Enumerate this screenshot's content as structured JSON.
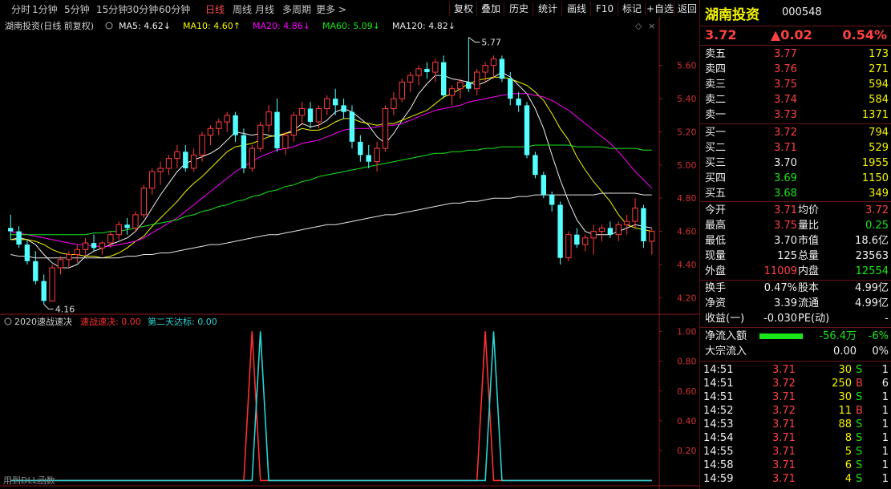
{
  "toolbar": {
    "timeframes": [
      "分时",
      "1分钟",
      "5分钟",
      "15分钟",
      "30分钟",
      "60分钟",
      "日线",
      "周线",
      "月线",
      "多周期",
      "更多 >"
    ],
    "active_timeframe": "日线",
    "buttons": [
      "复权",
      "叠加",
      "历史",
      "统计",
      "画线",
      "F10",
      "标记",
      "+自选",
      "返回"
    ]
  },
  "legend": {
    "title": "湖南投资(日线 前复权)",
    "items": [
      {
        "label": "MA5: 4.62↓",
        "color": "#f0f0f0"
      },
      {
        "label": "MA10: 4.60↑",
        "color": "#f5f500"
      },
      {
        "label": "MA20: 4.86↓",
        "color": "#ff00ff"
      },
      {
        "label": "MA60: 5.09↓",
        "color": "#19e619"
      },
      {
        "label": "MA120: 4.82↓",
        "color": "#e6e6e6"
      }
    ]
  },
  "indicator": {
    "name": "2020速战速决",
    "items": [
      {
        "label": "速战速决: 0.00",
        "color": "#ff3030"
      },
      {
        "label": "第二天达标: 0.00",
        "color": "#2ad3d3"
      }
    ]
  },
  "chart_data": [
    {
      "type": "candlestick",
      "y_ticks": [
        "5.60",
        "5.40",
        "5.20",
        "5.00",
        "4.80",
        "4.60",
        "4.40",
        "4.20"
      ],
      "ylim": [
        4.1,
        5.85
      ],
      "annotations": {
        "high": "5.77",
        "low": "4.16"
      },
      "candles": [
        [
          4.62,
          4.7,
          4.55,
          4.6
        ],
        [
          4.6,
          4.63,
          4.5,
          4.52
        ],
        [
          4.52,
          4.55,
          4.4,
          4.42
        ],
        [
          4.42,
          4.48,
          4.28,
          4.3
        ],
        [
          4.3,
          4.34,
          4.16,
          4.18
        ],
        [
          4.18,
          4.4,
          4.18,
          4.38
        ],
        [
          4.38,
          4.45,
          4.34,
          4.43
        ],
        [
          4.43,
          4.48,
          4.38,
          4.46
        ],
        [
          4.46,
          4.52,
          4.41,
          4.49
        ],
        [
          4.49,
          4.56,
          4.45,
          4.53
        ],
        [
          4.53,
          4.58,
          4.48,
          4.5
        ],
        [
          4.5,
          4.54,
          4.46,
          4.53
        ],
        [
          4.53,
          4.6,
          4.5,
          4.58
        ],
        [
          4.58,
          4.66,
          4.55,
          4.64
        ],
        [
          4.64,
          4.68,
          4.58,
          4.62
        ],
        [
          4.62,
          4.72,
          4.6,
          4.7
        ],
        [
          4.7,
          4.88,
          4.68,
          4.86
        ],
        [
          4.86,
          4.98,
          4.82,
          4.96
        ],
        [
          4.96,
          5.02,
          4.88,
          4.98
        ],
        [
          4.98,
          5.06,
          4.94,
          5.04
        ],
        [
          5.04,
          5.12,
          4.98,
          5.08
        ],
        [
          5.08,
          5.12,
          4.96,
          4.98
        ],
        [
          4.98,
          5.1,
          4.96,
          5.06
        ],
        [
          5.06,
          5.2,
          5.02,
          5.18
        ],
        [
          5.18,
          5.24,
          5.12,
          5.22
        ],
        [
          5.22,
          5.28,
          5.18,
          5.26
        ],
        [
          5.26,
          5.32,
          5.2,
          5.3
        ],
        [
          5.3,
          5.32,
          5.14,
          5.18
        ],
        [
          5.18,
          5.22,
          4.95,
          4.98
        ],
        [
          4.98,
          5.12,
          4.96,
          5.1
        ],
        [
          5.1,
          5.26,
          5.08,
          5.24
        ],
        [
          5.24,
          5.36,
          5.2,
          5.32
        ],
        [
          5.32,
          5.4,
          5.08,
          5.1
        ],
        [
          5.1,
          5.2,
          5.06,
          5.18
        ],
        [
          5.18,
          5.32,
          5.14,
          5.3
        ],
        [
          5.3,
          5.38,
          5.24,
          5.34
        ],
        [
          5.34,
          5.38,
          5.22,
          5.26
        ],
        [
          5.26,
          5.36,
          5.22,
          5.34
        ],
        [
          5.34,
          5.42,
          5.3,
          5.4
        ],
        [
          5.4,
          5.46,
          5.3,
          5.36
        ],
        [
          5.36,
          5.4,
          5.28,
          5.32
        ],
        [
          5.32,
          5.36,
          5.1,
          5.14
        ],
        [
          5.14,
          5.18,
          5.02,
          5.06
        ],
        [
          5.06,
          5.12,
          4.98,
          5.02
        ],
        [
          5.02,
          5.14,
          4.96,
          5.1
        ],
        [
          5.1,
          5.36,
          5.08,
          5.34
        ],
        [
          5.34,
          5.44,
          5.3,
          5.4
        ],
        [
          5.4,
          5.52,
          5.38,
          5.5
        ],
        [
          5.5,
          5.56,
          5.44,
          5.54
        ],
        [
          5.54,
          5.6,
          5.48,
          5.58
        ],
        [
          5.58,
          5.62,
          5.52,
          5.56
        ],
        [
          5.56,
          5.64,
          5.5,
          5.62
        ],
        [
          5.62,
          5.66,
          5.4,
          5.42
        ],
        [
          5.42,
          5.48,
          5.36,
          5.46
        ],
        [
          5.46,
          5.52,
          5.4,
          5.5
        ],
        [
          5.5,
          5.77,
          5.44,
          5.46
        ],
        [
          5.46,
          5.58,
          5.42,
          5.56
        ],
        [
          5.56,
          5.62,
          5.5,
          5.6
        ],
        [
          5.6,
          5.66,
          5.52,
          5.64
        ],
        [
          5.64,
          5.66,
          5.5,
          5.52
        ],
        [
          5.52,
          5.56,
          5.36,
          5.4
        ],
        [
          5.4,
          5.44,
          5.32,
          5.36
        ],
        [
          5.36,
          5.38,
          5.04,
          5.06
        ],
        [
          5.06,
          5.08,
          4.92,
          4.94
        ],
        [
          4.94,
          4.96,
          4.8,
          4.82
        ],
        [
          4.82,
          4.84,
          4.72,
          4.76
        ],
        [
          4.76,
          4.78,
          4.4,
          4.44
        ],
        [
          4.44,
          4.6,
          4.42,
          4.58
        ],
        [
          4.58,
          4.62,
          4.5,
          4.52
        ],
        [
          4.52,
          4.58,
          4.48,
          4.56
        ],
        [
          4.56,
          4.64,
          4.46,
          4.6
        ],
        [
          4.6,
          4.64,
          4.54,
          4.62
        ],
        [
          4.62,
          4.66,
          4.56,
          4.58
        ],
        [
          4.58,
          4.66,
          4.54,
          4.64
        ],
        [
          4.64,
          4.7,
          4.58,
          4.66
        ],
        [
          4.66,
          4.8,
          4.62,
          4.74
        ],
        [
          4.74,
          4.76,
          4.5,
          4.54
        ],
        [
          4.54,
          4.62,
          4.46,
          4.6
        ]
      ],
      "ma": {
        "MA5": {
          "color": "#f0f0f0",
          "values": [
            4.55,
            4.56,
            4.55,
            4.52,
            4.46,
            4.41,
            4.38,
            4.38,
            4.4,
            4.45,
            4.48,
            4.5,
            4.52,
            4.54,
            4.56,
            4.6,
            4.66,
            4.74,
            4.82,
            4.89,
            4.96,
            5.01,
            5.03,
            5.05,
            5.07,
            5.1,
            5.15,
            5.2,
            5.19,
            5.18,
            5.19,
            5.18,
            5.17,
            5.19,
            5.21,
            5.25,
            5.23,
            5.24,
            5.27,
            5.32,
            5.34,
            5.32,
            5.28,
            5.24,
            5.17,
            5.13,
            5.19,
            5.27,
            5.34,
            5.43,
            5.49,
            5.54,
            5.54,
            5.52,
            5.51,
            5.5,
            5.48,
            5.5,
            5.53,
            5.56,
            5.53,
            5.48,
            5.43,
            5.34,
            5.22,
            5.06,
            4.91,
            4.78,
            4.67,
            4.6,
            4.58,
            4.58,
            4.58,
            4.6,
            4.62,
            4.64,
            4.63,
            4.62
          ]
        },
        "MA10": {
          "color": "#f5f500",
          "values": [
            4.55,
            4.55,
            4.55,
            4.54,
            4.52,
            4.49,
            4.47,
            4.46,
            4.46,
            4.45,
            4.45,
            4.44,
            4.45,
            4.47,
            4.5,
            4.54,
            4.57,
            4.63,
            4.68,
            4.73,
            4.78,
            4.84,
            4.89,
            4.93,
            4.98,
            5.03,
            5.08,
            5.11,
            5.12,
            5.13,
            5.15,
            5.17,
            5.18,
            5.19,
            5.2,
            5.22,
            5.21,
            5.21,
            5.23,
            5.26,
            5.28,
            5.28,
            5.26,
            5.25,
            5.24,
            5.25,
            5.25,
            5.27,
            5.29,
            5.31,
            5.33,
            5.37,
            5.41,
            5.43,
            5.46,
            5.49,
            5.51,
            5.52,
            5.53,
            5.53,
            5.52,
            5.5,
            5.48,
            5.44,
            5.39,
            5.31,
            5.22,
            5.15,
            5.05,
            4.97,
            4.9,
            4.84,
            4.78,
            4.7,
            4.64,
            4.62,
            4.61,
            4.6
          ]
        },
        "MA20": {
          "color": "#ff00ff",
          "values": [
            4.6,
            4.59,
            4.58,
            4.57,
            4.56,
            4.55,
            4.54,
            4.53,
            4.52,
            4.52,
            4.51,
            4.51,
            4.51,
            4.52,
            4.53,
            4.54,
            4.56,
            4.59,
            4.62,
            4.65,
            4.68,
            4.72,
            4.76,
            4.8,
            4.84,
            4.88,
            4.92,
            4.96,
            4.99,
            5.02,
            5.05,
            5.07,
            5.09,
            5.1,
            5.11,
            5.13,
            5.14,
            5.15,
            5.17,
            5.19,
            5.21,
            5.22,
            5.22,
            5.22,
            5.23,
            5.24,
            5.24,
            5.25,
            5.27,
            5.29,
            5.31,
            5.33,
            5.34,
            5.35,
            5.36,
            5.38,
            5.39,
            5.4,
            5.41,
            5.42,
            5.43,
            5.43,
            5.43,
            5.42,
            5.41,
            5.39,
            5.36,
            5.33,
            5.29,
            5.25,
            5.21,
            5.17,
            5.13,
            5.08,
            5.02,
            4.96,
            4.91,
            4.86
          ]
        },
        "MA60": {
          "color": "#19e619",
          "values": [
            4.58,
            4.58,
            4.58,
            4.58,
            4.58,
            4.58,
            4.58,
            4.58,
            4.58,
            4.58,
            4.59,
            4.59,
            4.6,
            4.6,
            4.61,
            4.62,
            4.63,
            4.64,
            4.65,
            4.66,
            4.67,
            4.69,
            4.7,
            4.72,
            4.73,
            4.75,
            4.76,
            4.78,
            4.79,
            4.81,
            4.82,
            4.84,
            4.85,
            4.87,
            4.88,
            4.9,
            4.91,
            4.93,
            4.94,
            4.95,
            4.96,
            4.97,
            4.98,
            4.99,
            5.0,
            5.01,
            5.02,
            5.03,
            5.04,
            5.05,
            5.06,
            5.07,
            5.07,
            5.08,
            5.08,
            5.09,
            5.09,
            5.1,
            5.1,
            5.11,
            5.11,
            5.11,
            5.11,
            5.12,
            5.12,
            5.12,
            5.12,
            5.12,
            5.11,
            5.11,
            5.11,
            5.11,
            5.1,
            5.1,
            5.1,
            5.1,
            5.09,
            5.09
          ]
        },
        "MA120": {
          "color": "#e6e6e6",
          "values": [
            4.46,
            4.45,
            4.45,
            4.44,
            4.44,
            4.44,
            4.44,
            4.44,
            4.44,
            4.44,
            4.44,
            4.44,
            4.44,
            4.44,
            4.45,
            4.45,
            4.46,
            4.46,
            4.47,
            4.47,
            4.48,
            4.49,
            4.5,
            4.51,
            4.52,
            4.52,
            4.53,
            4.54,
            4.55,
            4.56,
            4.57,
            4.58,
            4.58,
            4.59,
            4.6,
            4.61,
            4.62,
            4.63,
            4.64,
            4.64,
            4.65,
            4.66,
            4.67,
            4.68,
            4.69,
            4.7,
            4.7,
            4.71,
            4.72,
            4.73,
            4.74,
            4.75,
            4.76,
            4.77,
            4.77,
            4.78,
            4.78,
            4.79,
            4.8,
            4.8,
            4.8,
            4.81,
            4.81,
            4.82,
            4.82,
            4.82,
            4.82,
            4.82,
            4.82,
            4.82,
            4.82,
            4.83,
            4.83,
            4.83,
            4.83,
            4.83,
            4.82,
            4.82
          ]
        }
      }
    },
    {
      "type": "line",
      "y_ticks": [
        "1.00",
        "0.80",
        "0.60",
        "0.40",
        "0.20"
      ],
      "ylim": [
        -0.03,
        1.05
      ],
      "series": [
        {
          "name": "速战速决",
          "color": "#ff3030",
          "spike_index": [
            29,
            57
          ]
        },
        {
          "name": "第二天达标",
          "color": "#2ad3d3",
          "spike_index": [
            30,
            58
          ]
        }
      ],
      "bars": 78
    }
  ],
  "footer_text": "用到DLL函数",
  "panel": {
    "stock_name": "湖南投资",
    "stock_code": "000548",
    "price": "3.72",
    "change": "▲0.02",
    "change_pct": "0.54%",
    "asks": [
      {
        "label": "卖五",
        "price": "3.77",
        "vol": "173"
      },
      {
        "label": "卖四",
        "price": "3.76",
        "vol": "271"
      },
      {
        "label": "卖三",
        "price": "3.75",
        "vol": "594"
      },
      {
        "label": "卖二",
        "price": "3.74",
        "vol": "584"
      },
      {
        "label": "卖一",
        "price": "3.73",
        "vol": "1371"
      }
    ],
    "bids": [
      {
        "label": "买一",
        "price": "3.72",
        "vol": "794",
        "pc": "red"
      },
      {
        "label": "买二",
        "price": "3.71",
        "vol": "529",
        "pc": "red"
      },
      {
        "label": "买三",
        "price": "3.70",
        "vol": "1955",
        "pc": "white"
      },
      {
        "label": "买四",
        "price": "3.69",
        "vol": "1150",
        "pc": "green"
      },
      {
        "label": "买五",
        "price": "3.68",
        "vol": "349",
        "pc": "green"
      }
    ],
    "stats": [
      {
        "l1": "今开",
        "v1": "3.71",
        "c1": "red",
        "l2": "均价",
        "v2": "3.72",
        "c2": "red"
      },
      {
        "l1": "最高",
        "v1": "3.75",
        "c1": "red",
        "l2": "量比",
        "v2": "0.25",
        "c2": "green"
      },
      {
        "l1": "最低",
        "v1": "3.70",
        "c1": "white",
        "l2": "市值",
        "v2": "18.6亿",
        "c2": "white"
      },
      {
        "l1": "现量",
        "v1": "125",
        "c1": "white",
        "l2": "总量",
        "v2": "23563",
        "c2": "white"
      },
      {
        "l1": "外盘",
        "v1": "11009",
        "c1": "red",
        "l2": "内盘",
        "v2": "12554",
        "c2": "green"
      }
    ],
    "fund": [
      {
        "l1": "换手",
        "v1": "0.47%",
        "l2": "股本",
        "v2": "4.99亿"
      },
      {
        "l1": "净资",
        "v1": "3.39",
        "l2": "流通",
        "v2": "4.99亿"
      },
      {
        "l1": "收益(一)",
        "v1": "-0.030",
        "l2": "PE(动)",
        "v2": "-"
      }
    ],
    "flow": [
      {
        "label": "净流入额",
        "bar": true,
        "v1": "-56.4万",
        "v2": "-6%"
      },
      {
        "label": "大宗流入",
        "bar": false,
        "v1": "0.00",
        "v2": "0%"
      }
    ],
    "ticks": [
      {
        "time": "14:51",
        "price": "3.71",
        "vol": "30",
        "bs": "S",
        "n": "1"
      },
      {
        "time": "14:51",
        "price": "3.72",
        "vol": "250",
        "bs": "B",
        "n": "6"
      },
      {
        "time": "14:51",
        "price": "3.71",
        "vol": "30",
        "bs": "S",
        "n": "1"
      },
      {
        "time": "14:52",
        "price": "3.72",
        "vol": "11",
        "bs": "B",
        "n": "1"
      },
      {
        "time": "14:53",
        "price": "3.71",
        "vol": "88",
        "bs": "S",
        "n": "1"
      },
      {
        "time": "14:54",
        "price": "3.71",
        "vol": "8",
        "bs": "S",
        "n": "1"
      },
      {
        "time": "14:55",
        "price": "3.71",
        "vol": "5",
        "bs": "S",
        "n": "1"
      },
      {
        "time": "14:58",
        "price": "3.71",
        "vol": "6",
        "bs": "S",
        "n": "1"
      },
      {
        "time": "14:59",
        "price": "3.71",
        "vol": "4",
        "bs": "S",
        "n": "1"
      }
    ]
  }
}
